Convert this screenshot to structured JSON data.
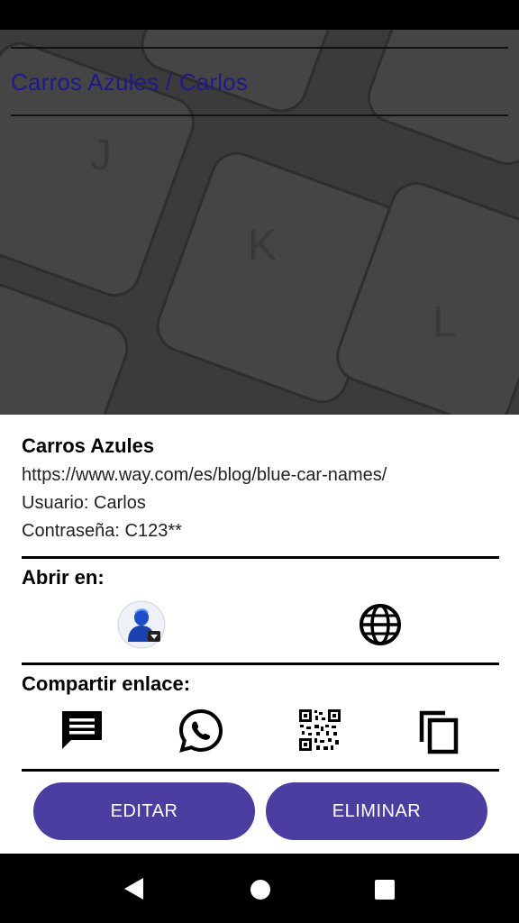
{
  "header": {
    "title": "Carros Azules / Carlos"
  },
  "details": {
    "site_name": "Carros Azules",
    "url": "https://www.way.com/es/blog/blue-car-names/",
    "user_line": "Usuario: Carlos",
    "password_line": "Contraseña: C123**"
  },
  "open_in": {
    "label": "Abrir en:",
    "options": [
      {
        "icon": "browser-app-icon"
      },
      {
        "icon": "globe-icon"
      }
    ]
  },
  "share": {
    "label": "Compartir enlace:",
    "options": [
      {
        "icon": "message-icon"
      },
      {
        "icon": "whatsapp-icon"
      },
      {
        "icon": "qr-code-icon"
      },
      {
        "icon": "copy-icon"
      }
    ]
  },
  "actions": {
    "edit_label": "EDITAR",
    "delete_label": "ELIMINAR"
  },
  "colors": {
    "title": "#1f1a8c",
    "button": "#4a3fa0"
  }
}
